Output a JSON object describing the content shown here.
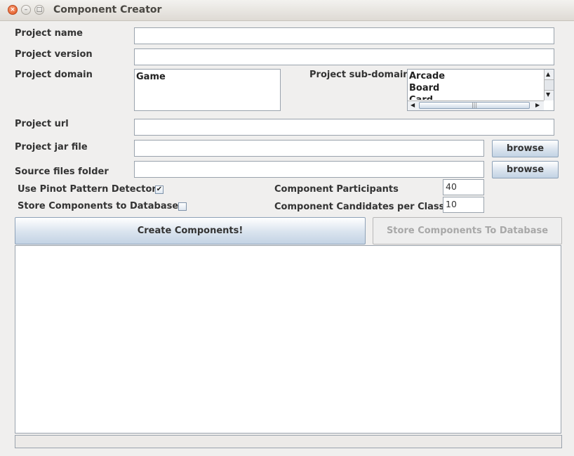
{
  "window": {
    "title": "Component Creator"
  },
  "form": {
    "project_name_label": "Project name",
    "project_version_label": "Project version",
    "project_domain_label": "Project domain",
    "project_subdomain_label": "Project sub-domain",
    "project_url_label": "Project url",
    "project_jar_label": "Project jar file",
    "source_folder_label": "Source files folder",
    "domains": [
      "Game"
    ],
    "subdomains": [
      "Arcade",
      "Board",
      "Card"
    ],
    "browse_label": "browse"
  },
  "options": {
    "pinot_label": "Use Pinot Pattern Detector",
    "pinot_checked": true,
    "store_label": "Store Components to Database",
    "store_checked": false,
    "participants_label": "Component Participants",
    "participants_value": "40",
    "candidates_label": "Component Candidates per Class",
    "candidates_value": "10"
  },
  "actions": {
    "create_label": "Create Components!",
    "store_db_label": "Store Components To Database"
  }
}
